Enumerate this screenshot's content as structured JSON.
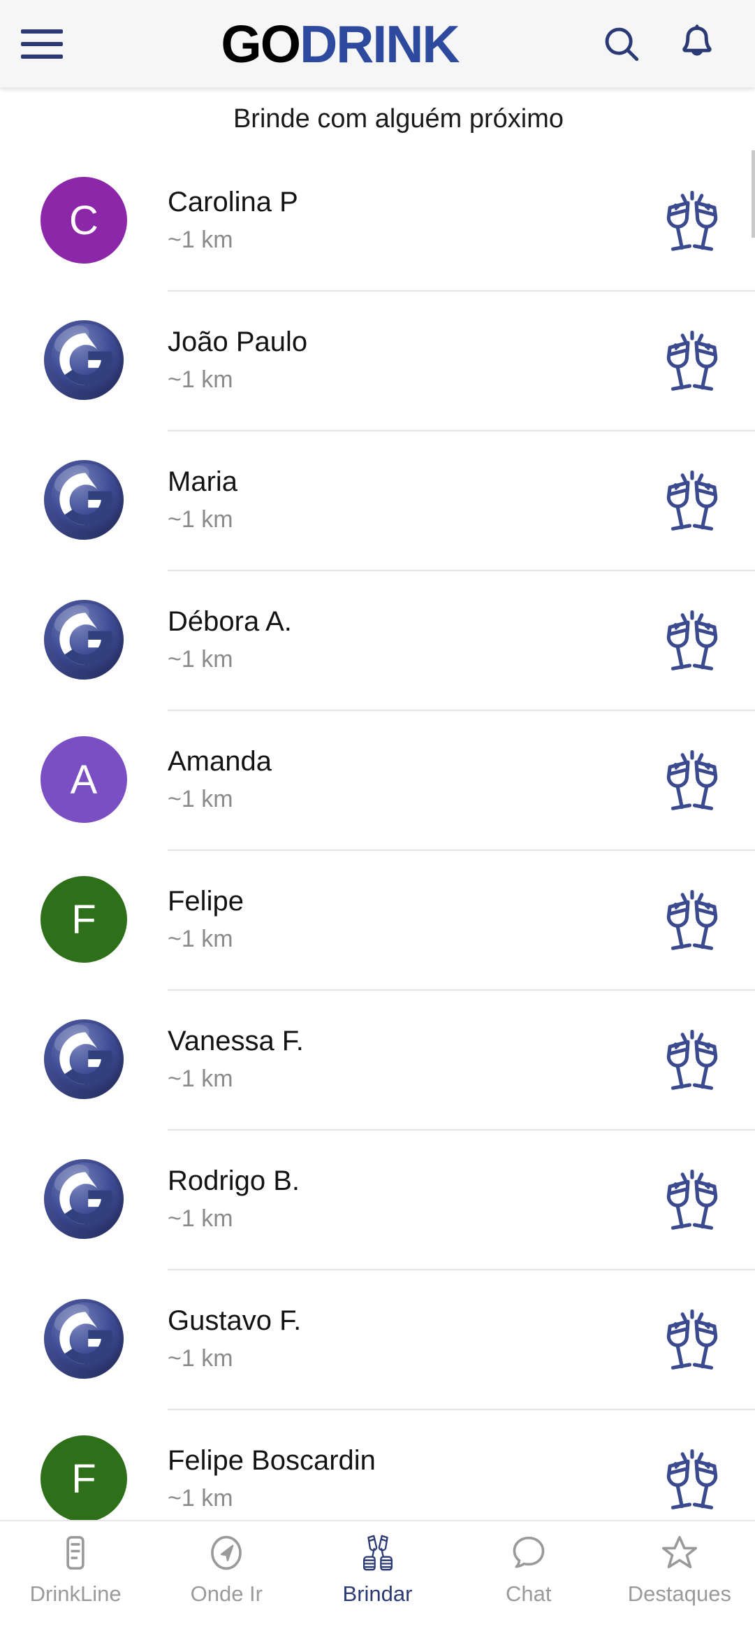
{
  "header": {
    "menu_icon": "hamburger-menu-icon",
    "brand_part1": "GO",
    "brand_part2": "DRINK",
    "search_icon": "search-icon",
    "bell_icon": "bell-icon",
    "brand_color": "#2e4a9e",
    "background": "#f6f6f7"
  },
  "main": {
    "subtitle": "Brinde com alguém próximo",
    "action_icon": "cheers-glasses-icon",
    "people": [
      {
        "name": "Carolina P",
        "distance": "~1 km",
        "avatar_type": "initial",
        "initial": "C",
        "avatar_color": "#8b27a8"
      },
      {
        "name": "João Paulo",
        "distance": "~1 km",
        "avatar_type": "logo",
        "initial": "G",
        "avatar_color": "#33438f"
      },
      {
        "name": "Maria",
        "distance": "~1 km",
        "avatar_type": "logo",
        "initial": "G",
        "avatar_color": "#33438f"
      },
      {
        "name": "Débora A.",
        "distance": "~1 km",
        "avatar_type": "logo",
        "initial": "G",
        "avatar_color": "#33438f"
      },
      {
        "name": "Amanda",
        "distance": "~1 km",
        "avatar_type": "initial",
        "initial": "A",
        "avatar_color": "#7a4fc4"
      },
      {
        "name": "Felipe",
        "distance": "~1 km",
        "avatar_type": "initial",
        "initial": "F",
        "avatar_color": "#2e7019"
      },
      {
        "name": "Vanessa F.",
        "distance": "~1 km",
        "avatar_type": "logo",
        "initial": "G",
        "avatar_color": "#33438f"
      },
      {
        "name": "Rodrigo B.",
        "distance": "~1 km",
        "avatar_type": "logo",
        "initial": "G",
        "avatar_color": "#33438f"
      },
      {
        "name": "Gustavo F.",
        "distance": "~1 km",
        "avatar_type": "logo",
        "initial": "G",
        "avatar_color": "#33438f"
      },
      {
        "name": "Felipe Boscardin",
        "distance": "~1 km",
        "avatar_type": "initial",
        "initial": "F",
        "avatar_color": "#2e7019"
      }
    ]
  },
  "bottom_nav": {
    "active": "Brindar",
    "items": [
      {
        "label": "DrinkLine",
        "icon": "drinkline-list-icon",
        "active": false
      },
      {
        "label": "Onde Ir",
        "icon": "navigation-arrow-icon",
        "active": false
      },
      {
        "label": "Brindar",
        "icon": "champagne-toast-icon",
        "active": true
      },
      {
        "label": "Chat",
        "icon": "speech-bubble-icon",
        "active": false
      },
      {
        "label": "Destaques",
        "icon": "star-icon",
        "active": false
      }
    ],
    "active_color": "#2b3a75",
    "inactive_color": "#9a9a9a"
  }
}
